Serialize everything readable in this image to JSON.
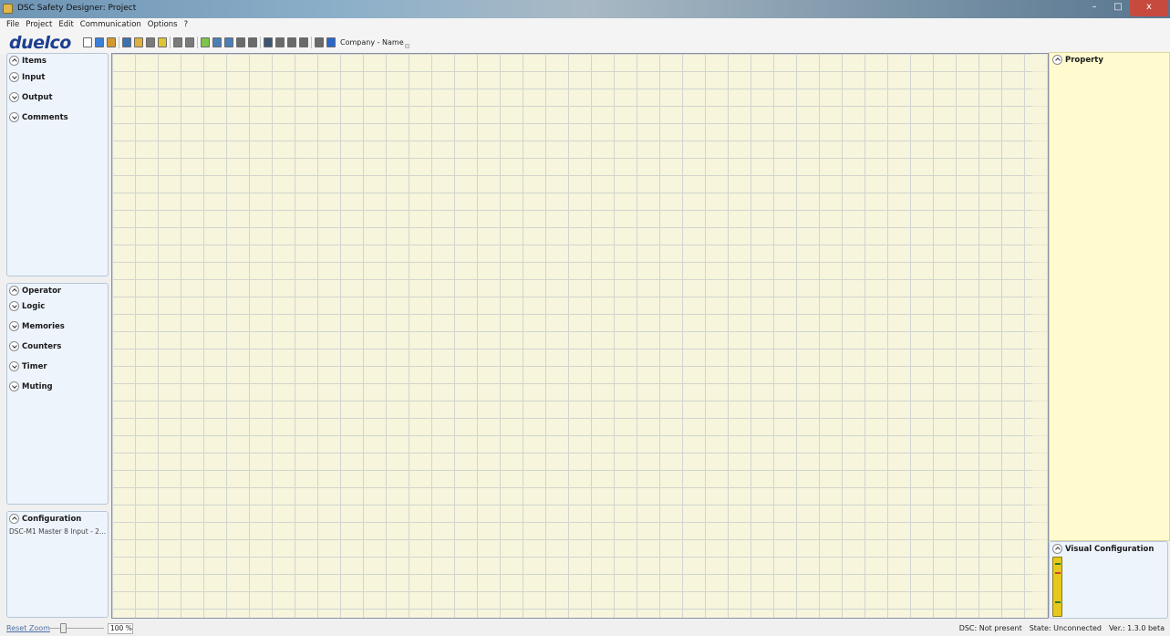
{
  "window": {
    "title": "DSC Safety Designer: Project"
  },
  "menu": [
    "File",
    "Project",
    "Edit",
    "Communication",
    "Options",
    "?"
  ],
  "toolbar": {
    "logo": "duelco",
    "company": "Company - Name",
    "tool_icons": [
      "new-project-icon",
      "rename-icon",
      "user-icon",
      "save-icon",
      "open-icon",
      "print-icon",
      "edit-icon",
      "undo-icon",
      "redo-icon",
      "check-icon",
      "compile-icon",
      "upload-icon",
      "monitor-icon",
      "probe-icon",
      "image-icon",
      "zoom-icon",
      "clipboard-icon",
      "config-icon",
      "tools-icon",
      "help-icon"
    ],
    "tool_colors": [
      "#ffffff",
      "#3b7fd6",
      "#d59a2e",
      "#3f6fb5",
      "#e0b03a",
      "#7a7a7a",
      "#e1c232",
      "#7a7a7a",
      "#7a7a7a",
      "#7ec44a",
      "#4b7fb8",
      "#4b7fb8",
      "#6a6a6a",
      "#6a6a6a",
      "#3d5570",
      "#6a6a6a",
      "#6a6a6a",
      "#6a6a6a",
      "#6a6a6a",
      "#2a66c9"
    ]
  },
  "items_panel": {
    "title": "Items",
    "categories": [
      "Input",
      "Output",
      "Comments"
    ]
  },
  "operator_panel": {
    "title": "Operator",
    "categories": [
      "Logic",
      "Memories",
      "Counters",
      "Timer",
      "Muting"
    ]
  },
  "configuration_panel": {
    "title": "Configuration",
    "text": "DSC-M1 Master 8 Input - 2..."
  },
  "property_panel": {
    "title": "Property"
  },
  "visual_panel": {
    "title": "Visual Configuration"
  },
  "statusbar": {
    "reset_zoom": "Reset Zoom",
    "zoom_value": "100 %",
    "dsc": "DSC: Not present",
    "state": "State: Unconnected",
    "version": "Ver.: 1.3.0 beta"
  }
}
